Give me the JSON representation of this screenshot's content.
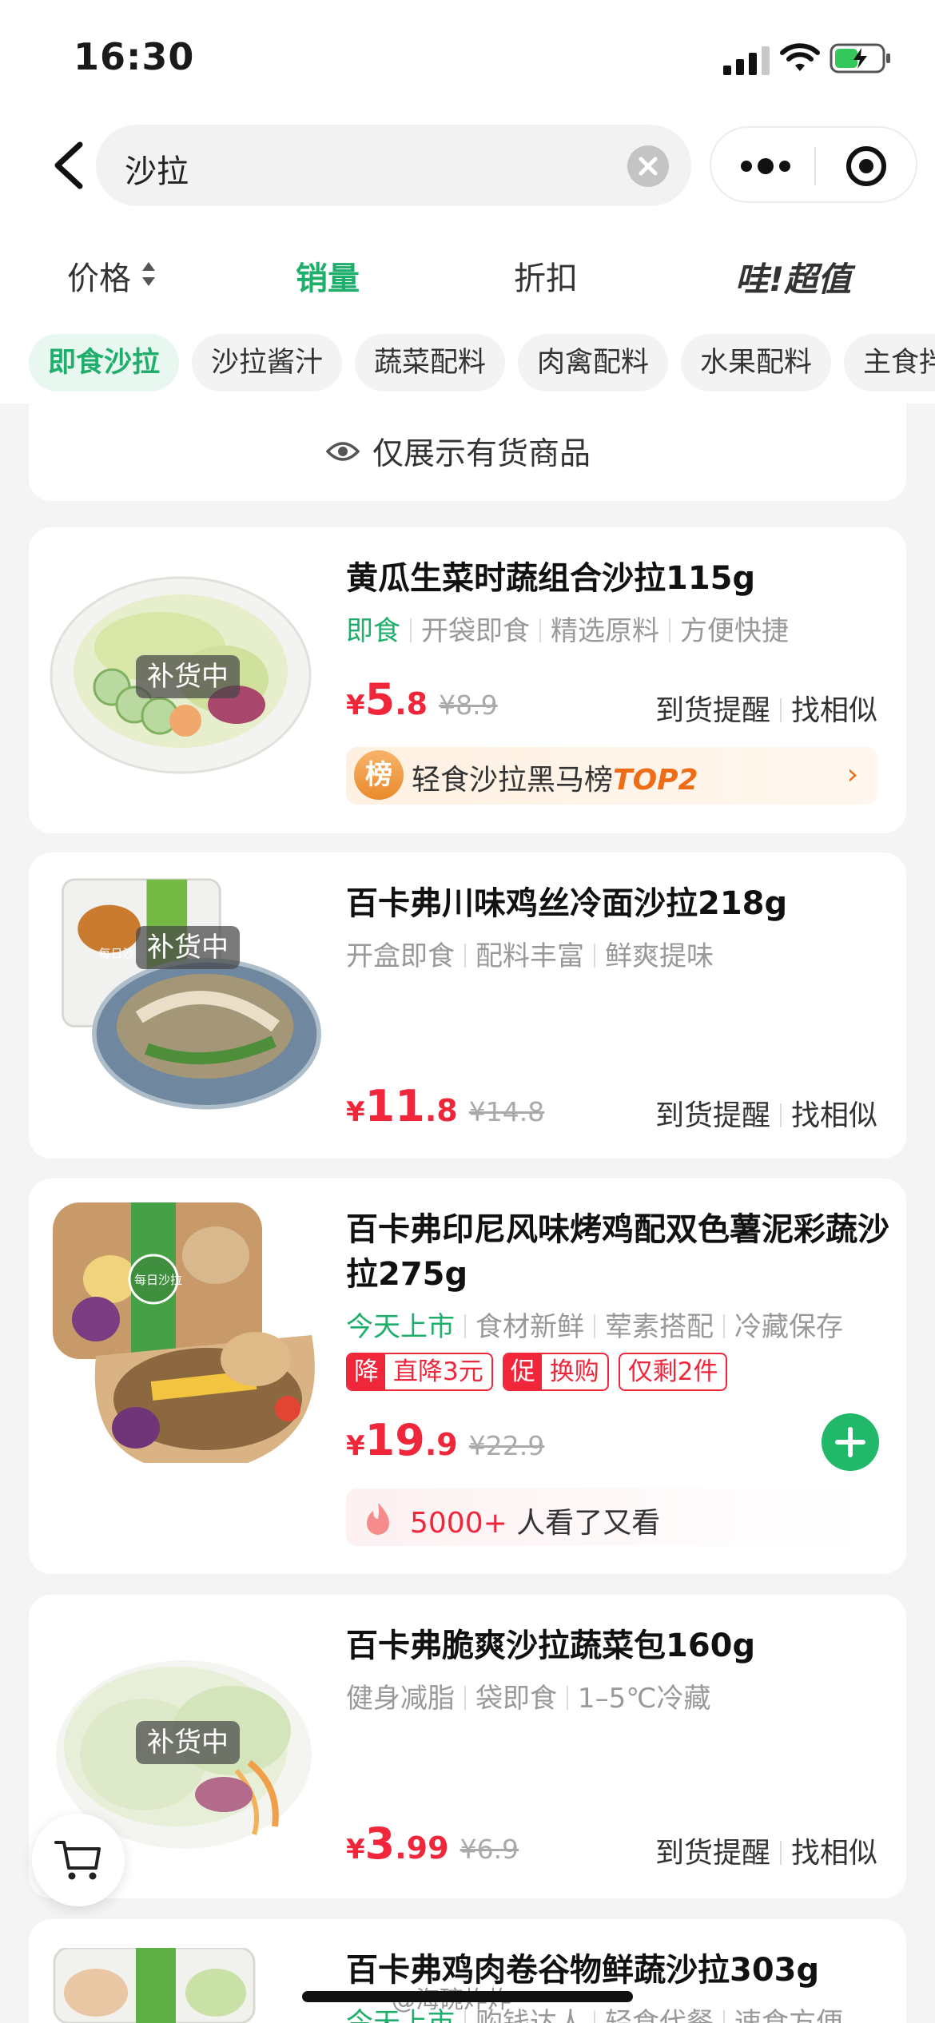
{
  "status_bar": {
    "time": "16:30"
  },
  "search": {
    "query": "沙拉"
  },
  "sort_tabs": {
    "price": "价格",
    "sales": "销量",
    "discount": "折扣",
    "wow": "哇!超值"
  },
  "categories": [
    "即食沙拉",
    "沙拉酱汁",
    "蔬菜配料",
    "肉禽配料",
    "水果配料",
    "主食拌"
  ],
  "notice": "仅展示有货商品",
  "restock_label": "补货中",
  "actions": {
    "remind": "到货提醒",
    "similar": "找相似"
  },
  "currency": "¥",
  "products": [
    {
      "title": "黄瓜生菜时蔬组合沙拉115g",
      "tag_highlight": "即食",
      "tags": [
        "开袋即食",
        "精选原料",
        "方便快捷"
      ],
      "price_int": "5",
      "price_dec": ".8",
      "orig": "¥8.9",
      "rank_badge": "榜",
      "rank_text": "轻食沙拉黑马榜",
      "rank_top": "TOP2"
    },
    {
      "title": "百卡弗川味鸡丝冷面沙拉218g",
      "tags": [
        "开盒即食",
        "配料丰富",
        "鲜爽提味"
      ],
      "price_int": "11",
      "price_dec": ".8",
      "orig": "¥14.8"
    },
    {
      "title": "百卡弗印尼风味烤鸡配双色薯泥彩蔬沙拉275g",
      "tag_highlight": "今天上市",
      "tags": [
        "食材新鲜",
        "荤素搭配",
        "冷藏保存"
      ],
      "promos": [
        {
          "prefix": "降",
          "text": "直降3元"
        },
        {
          "prefix": "促",
          "text": "换购"
        },
        {
          "prefix": "",
          "text": "仅剩2件"
        }
      ],
      "price_int": "19",
      "price_dec": ".9",
      "orig": "¥22.9",
      "viewed_count": "5000+",
      "viewed_text": "人看了又看"
    },
    {
      "title": "百卡弗脆爽沙拉蔬菜包160g",
      "tags": [
        "健身减脂",
        "袋即食",
        "1–5℃冷藏"
      ],
      "price_int": "3",
      "price_dec": ".99",
      "orig": "¥6.9"
    },
    {
      "title": "百卡弗鸡肉卷谷物鲜蔬沙拉303g",
      "tag_highlight": "今天上市",
      "tags": [
        "购钱达人",
        "轻食代餐",
        "速食方便"
      ]
    }
  ],
  "watermark": "@海碗炸炸"
}
